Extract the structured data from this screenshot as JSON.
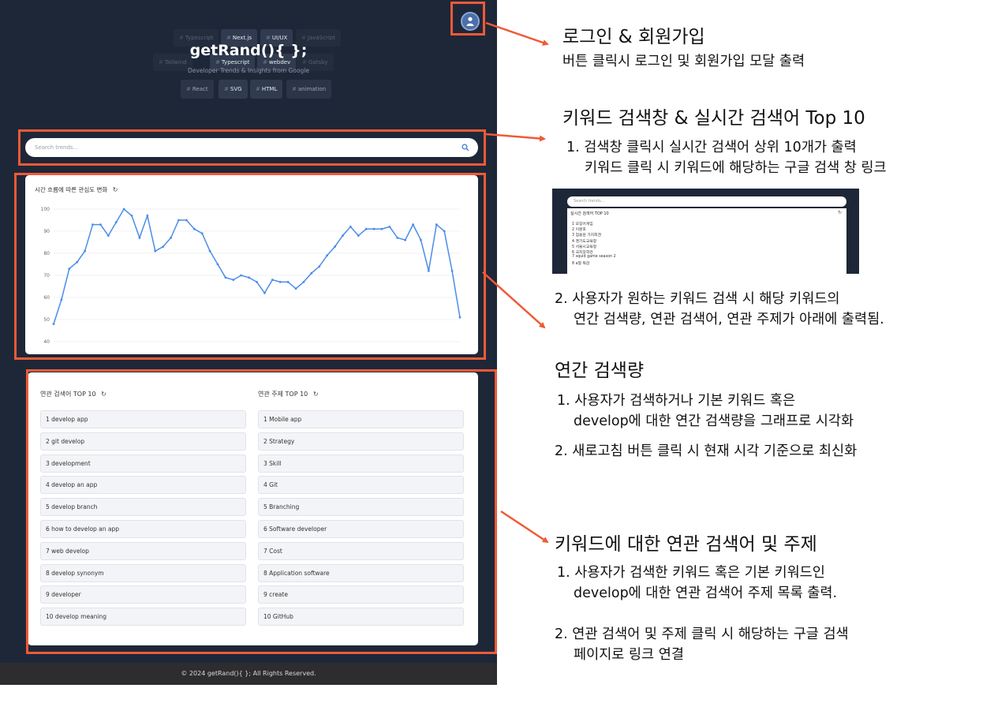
{
  "header": {
    "avatar_icon": "user-icon",
    "hero_title": "getRand(){ };",
    "hero_subtitle": "Developer Trends & Insights from Google",
    "tag_cloud": [
      {
        "label": "Typescript",
        "style": "dim"
      },
      {
        "label": "Next.js",
        "style": "bright"
      },
      {
        "label": "UI/UX",
        "style": "bright"
      },
      {
        "label": "JavaScript",
        "style": "dim"
      },
      {
        "label": "Tailwind",
        "style": "dim"
      },
      {
        "label": "Typescript",
        "style": "bright"
      },
      {
        "label": "webdev",
        "style": "bright"
      },
      {
        "label": "Gatsby",
        "style": "dim"
      },
      {
        "label": "React",
        "style": "normal"
      },
      {
        "label": "SVG",
        "style": "bright"
      },
      {
        "label": "HTML",
        "style": "bright"
      },
      {
        "label": "animation",
        "style": "normal"
      }
    ]
  },
  "search": {
    "placeholder": "Search trends...",
    "icon": "search-icon"
  },
  "chart_card": {
    "title": "시간 흐름에 따른 관심도 변화",
    "refresh_symbol": "↻"
  },
  "chart_data": {
    "type": "line",
    "title": "시간 흐름에 따른 관심도 변화",
    "xlabel": "",
    "ylabel": "",
    "ylim": [
      40,
      100
    ],
    "yticks": [
      40,
      50,
      60,
      70,
      80,
      90,
      100
    ],
    "grid": true,
    "color": "#4a8de8",
    "series": [
      {
        "values": [
          48,
          59,
          73,
          76,
          81,
          93,
          93,
          88,
          94,
          100,
          97,
          87,
          97,
          81,
          83,
          87,
          95,
          95,
          91,
          89,
          81,
          75,
          69,
          68,
          70,
          69,
          67,
          62,
          68,
          67,
          67,
          64,
          67,
          71,
          74,
          79,
          83,
          88,
          92,
          88,
          91,
          91,
          91,
          92,
          87,
          86,
          93,
          86,
          72,
          93,
          90,
          72,
          51
        ]
      }
    ]
  },
  "related": {
    "queries_title": "연관 검색어 TOP 10",
    "topics_title": "연관 주제 TOP 10",
    "refresh_symbol": "↻",
    "queries": [
      "1 develop app",
      "2 git develop",
      "3 development",
      "4 develop an app",
      "5 develop branch",
      "6 how to develop an app",
      "7 web develop",
      "8 develop synonym",
      "9 developer",
      "10 develop meaning"
    ],
    "topics": [
      "1 Mobile app",
      "2 Strategy",
      "3 Skill",
      "4 Git",
      "5 Branching",
      "6 Software developer",
      "7 Cost",
      "8 Application software",
      "9 create",
      "10 GitHub"
    ]
  },
  "footer": {
    "text": "© 2024 getRand(){ }; All Rights Reserved."
  },
  "annotations": {
    "login": {
      "heading": "로그인 & 회원가입",
      "line1": "버튼 클릭시 로그인 및 회원가입 모달 출력"
    },
    "search": {
      "heading": "키워드 검색창 & 실시간 검색어 Top 10",
      "line1": "1. 검색창 클릭시 실시간 검색어 상위 10개가 출력",
      "line2": "키워드 클릭 시 키워드에 해당하는 구글 검색 창 링크",
      "line3": "2. 사용자가 원하는 키워드 검색 시 해당 키워드의",
      "line4": "연간 검색량, 연관 검색어, 연관 주제가 아래에 출력됨."
    },
    "mini_preview": {
      "placeholder": "Search trends...",
      "title": "실시간 검색어 TOP 10",
      "refresh_symbol": "↻",
      "items": [
        "1 오징어게임",
        "2 이문호",
        "3 엄용원 가지회견",
        "4 경기도교육청",
        "5 서울시교육청",
        "6 국지장학관",
        "7 squid game season 2",
        "8 a형 독감"
      ]
    },
    "volume": {
      "heading": "연간 검색량",
      "line1": "1. 사용자가 검색하거나 기본 키워드 혹은",
      "line2": "develop에 대한 연간 검색량을 그래프로 시각화",
      "line3": "2. 새로고침 버튼 클릭 시 현재 시각 기준으로 최신화"
    },
    "related": {
      "heading": "키워드에 대한 연관 검색어 및 주제",
      "line1": "1. 사용자가 검색한 키워드 혹은 기본 키워드인",
      "line2": "develop에 대한 연관 검색어 주제 목록 출력.",
      "line3": "2. 연관 검색어 및 주제 클릭 시 해당하는 구글 검색",
      "line4": "페이지로 링크 연결"
    }
  },
  "colors": {
    "app_background": "#1e2738",
    "highlight": "#ef5a36",
    "line": "#4a8de8"
  }
}
